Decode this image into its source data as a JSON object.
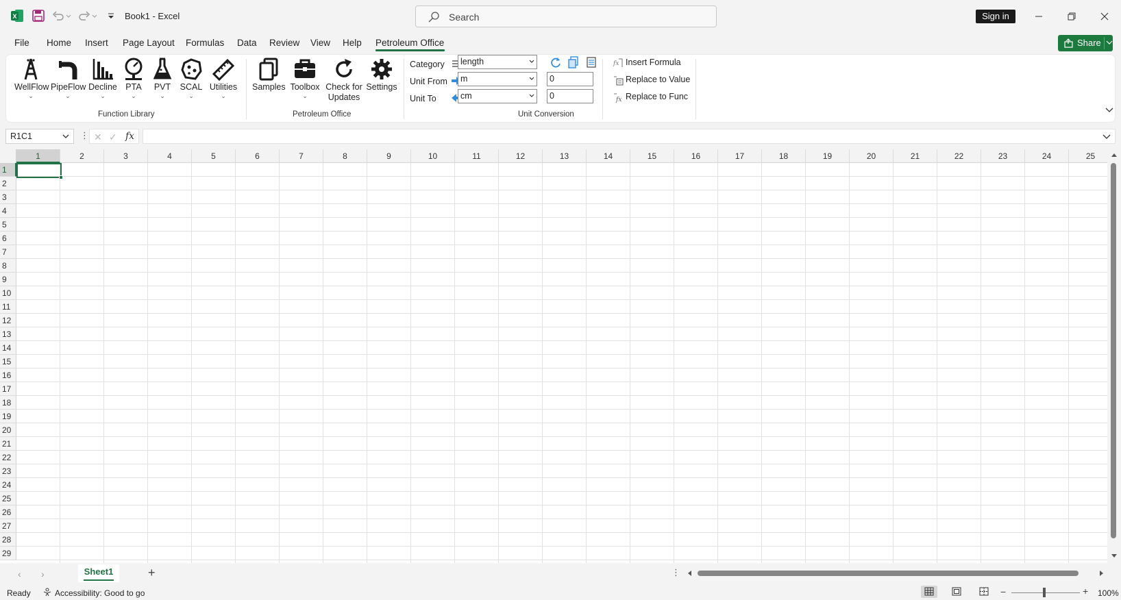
{
  "app": {
    "title": "Book1  -  Excel"
  },
  "search": {
    "placeholder": "Search"
  },
  "account": {
    "signin": "Sign in"
  },
  "tabs": [
    "File",
    "Home",
    "Insert",
    "Page Layout",
    "Formulas",
    "Data",
    "Review",
    "View",
    "Help",
    "Petroleum Office"
  ],
  "active_tab": "Petroleum Office",
  "share": {
    "label": "Share"
  },
  "ribbon": {
    "function_library": {
      "label": "Function Library",
      "buttons": [
        "WellFlow",
        "PipeFlow",
        "Decline",
        "PTA",
        "PVT",
        "SCAL",
        "Utilities"
      ]
    },
    "petroleum_office": {
      "label": "Petroleum Office",
      "samples": "Samples",
      "toolbox": "Toolbox",
      "check_updates_1": "Check for",
      "check_updates_2": "Updates",
      "settings": "Settings"
    },
    "unit_conversion": {
      "label": "Unit Conversion",
      "category_label": "Category",
      "category_value": "length",
      "unit_from_label": "Unit From",
      "unit_from_value": "m",
      "unit_to_label": "Unit To",
      "unit_to_value": "cm",
      "from_number": "0",
      "to_number": "0"
    },
    "formula_tools": {
      "insert_formula": "Insert Formula",
      "replace_value": "Replace to Value",
      "replace_func": "Replace to Func"
    }
  },
  "formula_bar": {
    "name_box": "R1C1",
    "fx": "fx",
    "content": ""
  },
  "grid": {
    "columns": [
      "1",
      "2",
      "3",
      "4",
      "5",
      "6",
      "7",
      "8",
      "9",
      "10",
      "11",
      "12",
      "13",
      "14",
      "15",
      "16",
      "17",
      "18",
      "19",
      "20",
      "21",
      "22",
      "23",
      "24",
      "25"
    ],
    "rows": [
      "1",
      "2",
      "3",
      "4",
      "5",
      "6",
      "7",
      "8",
      "9",
      "10",
      "11",
      "12",
      "13",
      "14",
      "15",
      "16",
      "17",
      "18",
      "19",
      "20",
      "21",
      "22",
      "23",
      "24",
      "25",
      "26",
      "27",
      "28",
      "29"
    ],
    "selected_cell": "R1C1"
  },
  "sheets": {
    "tabs": [
      "Sheet1"
    ],
    "active": "Sheet1"
  },
  "status": {
    "ready": "Ready",
    "accessibility": "Accessibility: Good to go",
    "zoom": "100%"
  },
  "colors": {
    "accent": "#217346",
    "share": "#1c7a3f",
    "arrow_blue": "#2f8ee0"
  }
}
